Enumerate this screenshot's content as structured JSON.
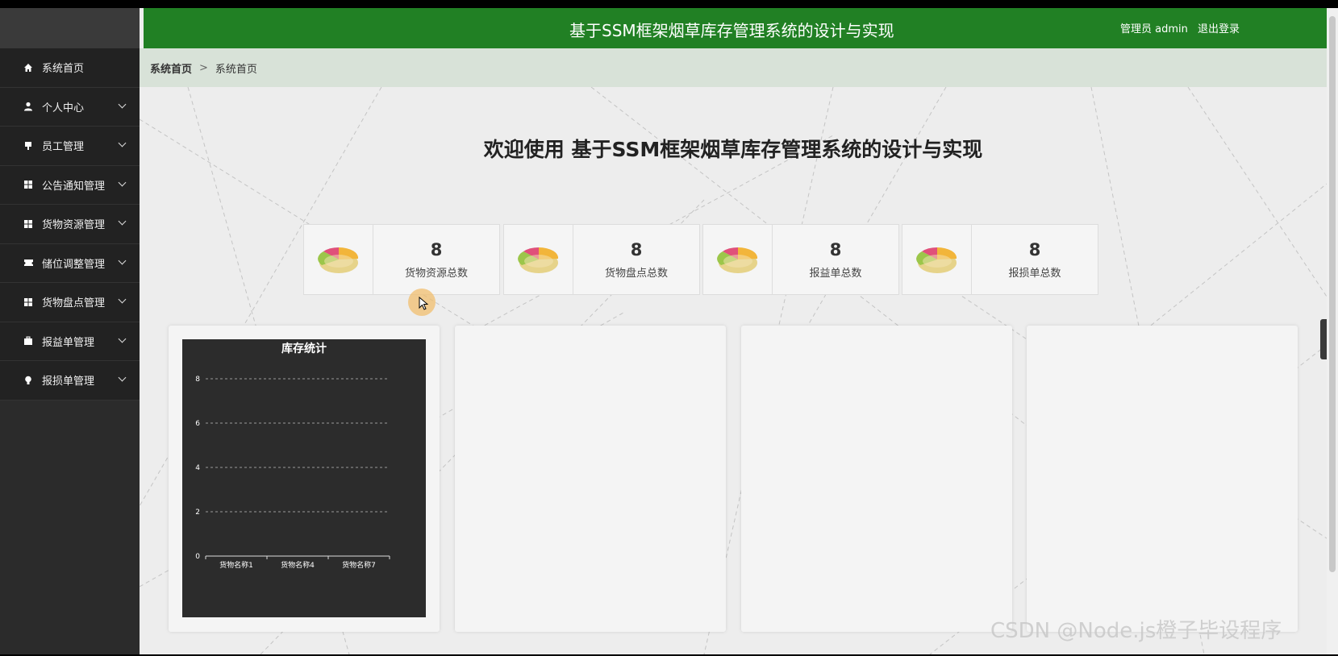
{
  "header": {
    "title": "基于SSM框架烟草库存管理系统的设计与实现",
    "user_label": "管理员 admin",
    "logout_label": "退出登录",
    "bg_color": "#218024"
  },
  "sidebar": {
    "items": [
      {
        "label": "系统首页",
        "icon": "home-icon",
        "has_submenu": false
      },
      {
        "label": "个人中心",
        "icon": "user-icon",
        "has_submenu": true
      },
      {
        "label": "员工管理",
        "icon": "badge-icon",
        "has_submenu": true
      },
      {
        "label": "公告通知管理",
        "icon": "grid-icon",
        "has_submenu": true
      },
      {
        "label": "货物资源管理",
        "icon": "grid-icon",
        "has_submenu": true
      },
      {
        "label": "储位调整管理",
        "icon": "ticket-icon",
        "has_submenu": true
      },
      {
        "label": "货物盘点管理",
        "icon": "grid-icon",
        "has_submenu": true
      },
      {
        "label": "报益单管理",
        "icon": "briefcase-icon",
        "has_submenu": true
      },
      {
        "label": "报损单管理",
        "icon": "bulb-icon",
        "has_submenu": true
      }
    ]
  },
  "breadcrumb": {
    "home": "系统首页",
    "separator": ">",
    "current": "系统首页"
  },
  "welcome": "欢迎使用 基于SSM框架烟草库存管理系统的设计与实现",
  "stats": [
    {
      "value": "8",
      "label": "货物资源总数"
    },
    {
      "value": "8",
      "label": "货物盘点总数"
    },
    {
      "value": "8",
      "label": "报益单总数"
    },
    {
      "value": "8",
      "label": "报损单总数"
    }
  ],
  "chart_data": {
    "type": "bar",
    "title": "库存统计",
    "categories": [
      "货物名称1",
      "货物名称4",
      "货物名称7"
    ],
    "y_ticks": [
      "0",
      "2",
      "4",
      "6",
      "8"
    ],
    "ylim": [
      0,
      8
    ],
    "grid": true,
    "xlabel": "",
    "ylabel": ""
  },
  "watermark": "CSDN @Node.js橙子毕设程序"
}
